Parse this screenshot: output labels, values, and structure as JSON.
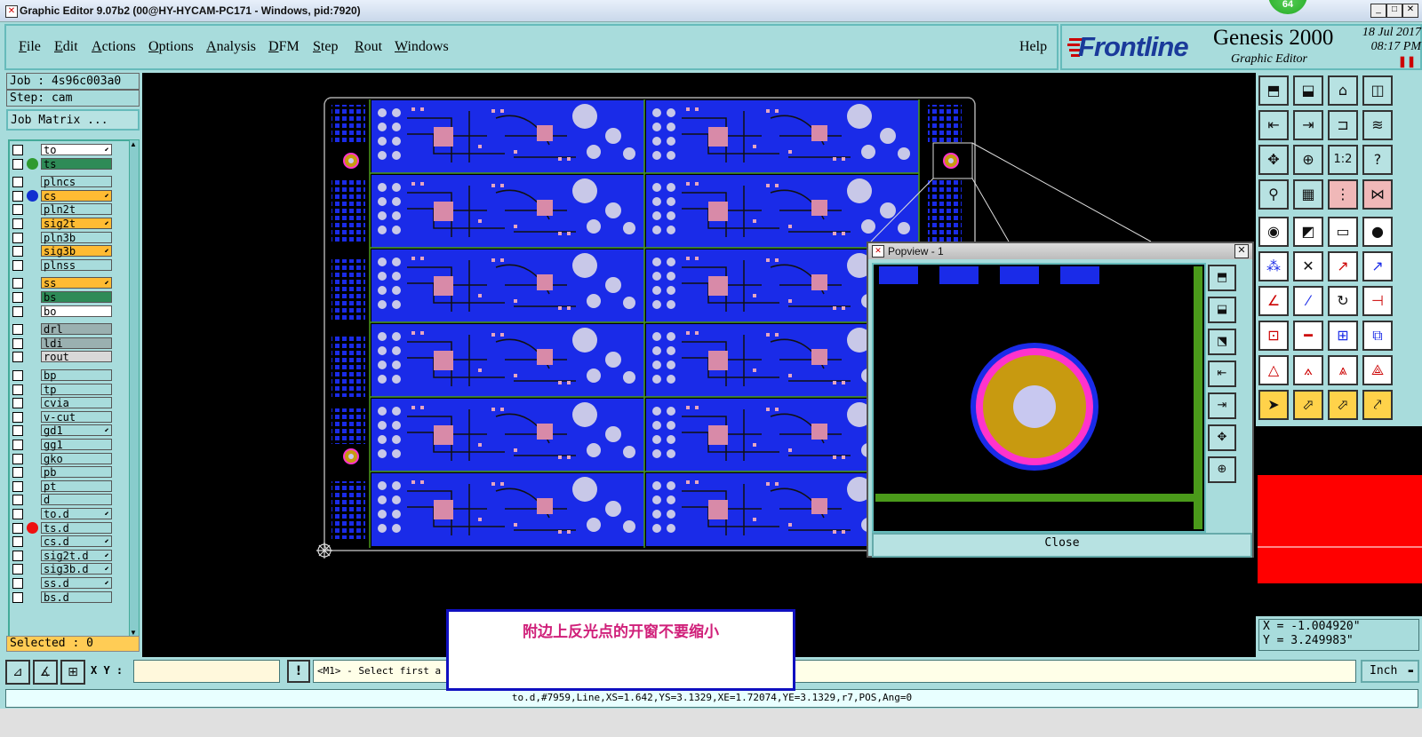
{
  "window": {
    "title": "Graphic Editor 9.07b2 (00@HY-HYCAM-PC171 - Windows, pid:7920)",
    "badge": "64",
    "min": "_",
    "max": "□",
    "close": "✕"
  },
  "menu": {
    "items": [
      "File",
      "Edit",
      "Actions",
      "Options",
      "Analysis",
      "DFM",
      "Step",
      "Rout",
      "Windows"
    ],
    "help": "Help"
  },
  "brand": {
    "logo": "Frontline",
    "product": "Genesis 2000",
    "subtitle": "Graphic Editor",
    "date": "18 Jul 2017",
    "time": "08:17 PM"
  },
  "job": {
    "job_line": "Job : 4s96c003a0",
    "step_line": "Step: cam",
    "matrix_button": "Job Matrix ..."
  },
  "layers": [
    {
      "name": "to",
      "color": "#ffffff",
      "arrow": true,
      "dot": ""
    },
    {
      "name": "ts",
      "color": "#2e8b57",
      "arrow": false,
      "dot": "#2f9a2f"
    },
    {
      "name": "plncs",
      "color": "#a8dcdc",
      "arrow": false,
      "dot": ""
    },
    {
      "name": "cs",
      "color": "#ffbb33",
      "arrow": true,
      "dot": "#1030d0"
    },
    {
      "name": "pln2t",
      "color": "#a8dcdc",
      "arrow": false,
      "dot": ""
    },
    {
      "name": "sig2t",
      "color": "#ffbb33",
      "arrow": true,
      "dot": ""
    },
    {
      "name": "pln3b",
      "color": "#a8dcdc",
      "arrow": false,
      "dot": ""
    },
    {
      "name": "sig3b",
      "color": "#ffbb33",
      "arrow": true,
      "dot": ""
    },
    {
      "name": "plnss",
      "color": "#a8dcdc",
      "arrow": false,
      "dot": ""
    },
    {
      "name": "ss",
      "color": "#ffbb33",
      "arrow": true,
      "dot": ""
    },
    {
      "name": "bs",
      "color": "#2e8b57",
      "arrow": false,
      "dot": ""
    },
    {
      "name": "bo",
      "color": "#ffffff",
      "arrow": false,
      "dot": ""
    },
    {
      "name": "drl",
      "color": "#9ab0b0",
      "arrow": false,
      "dot": ""
    },
    {
      "name": "ldi",
      "color": "#9ab0b0",
      "arrow": false,
      "dot": ""
    },
    {
      "name": "rout",
      "color": "#d8d8d8",
      "arrow": false,
      "dot": ""
    },
    {
      "name": "bp",
      "color": "#a8dcdc",
      "arrow": false,
      "dot": ""
    },
    {
      "name": "tp",
      "color": "#a8dcdc",
      "arrow": false,
      "dot": ""
    },
    {
      "name": "cvia",
      "color": "#a8dcdc",
      "arrow": false,
      "dot": ""
    },
    {
      "name": "v-cut",
      "color": "#a8dcdc",
      "arrow": false,
      "dot": ""
    },
    {
      "name": "gd1",
      "color": "#a8dcdc",
      "arrow": true,
      "dot": ""
    },
    {
      "name": "gg1",
      "color": "#a8dcdc",
      "arrow": false,
      "dot": ""
    },
    {
      "name": "gko",
      "color": "#a8dcdc",
      "arrow": false,
      "dot": ""
    },
    {
      "name": "pb",
      "color": "#a8dcdc",
      "arrow": false,
      "dot": ""
    },
    {
      "name": "pt",
      "color": "#a8dcdc",
      "arrow": false,
      "dot": ""
    },
    {
      "name": "d",
      "color": "#a8dcdc",
      "arrow": false,
      "dot": ""
    },
    {
      "name": "to.d",
      "color": "#a8dcdc",
      "arrow": true,
      "dot": ""
    },
    {
      "name": "ts.d",
      "color": "#a8dcdc",
      "arrow": false,
      "dot": "#ee1111"
    },
    {
      "name": "cs.d",
      "color": "#a8dcdc",
      "arrow": true,
      "dot": ""
    },
    {
      "name": "sig2t.d",
      "color": "#a8dcdc",
      "arrow": true,
      "dot": ""
    },
    {
      "name": "sig3b.d",
      "color": "#a8dcdc",
      "arrow": true,
      "dot": ""
    },
    {
      "name": "ss.d",
      "color": "#a8dcdc",
      "arrow": true,
      "dot": ""
    },
    {
      "name": "bs.d",
      "color": "#a8dcdc",
      "arrow": false,
      "dot": ""
    }
  ],
  "selected": "Selected : 0",
  "popview": {
    "title": "Popview - 1",
    "close_label": "Close"
  },
  "note": {
    "text": "附边上反光点的开窗不要缩小"
  },
  "coords": {
    "x": "X = -1.004920\"",
    "y": "Y = 3.249983\""
  },
  "command": {
    "xy_label": "X Y :",
    "xy_value": "",
    "prompt": "<M1> - Select first a",
    "unit": "Inch"
  },
  "status": "to.d,#7959,Line,XS=1.642,YS=3.1329,XE=1.72074,YE=3.1329,r7,POS,Ang=0",
  "colors": {
    "panel": "#a8dcdc",
    "board_blue": "#1a2be8",
    "highlight_red": "#ff0000",
    "pad_magenta": "#ff33cc",
    "pad_gold": "#c89a10",
    "trace_green": "#4a9a1a"
  }
}
